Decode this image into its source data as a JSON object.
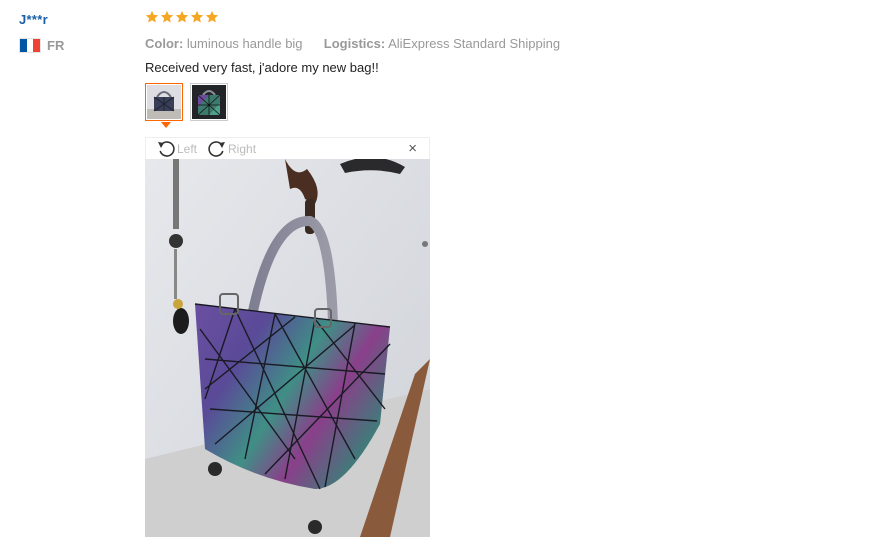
{
  "user": {
    "name": "J***r",
    "country_code": "FR"
  },
  "review": {
    "rating": 5,
    "stars": [
      1,
      2,
      3,
      4,
      5
    ],
    "color_label": "Color:",
    "color_value": "luminous handle big",
    "logistics_label": "Logistics:",
    "logistics_value": "AliExpress Standard Shipping",
    "comment": "Received very fast, j'adore my new bag!!"
  },
  "viewer": {
    "rotate_left": "Left",
    "rotate_right": "Right",
    "close": "×"
  },
  "colors": {
    "star": "#f5a623",
    "accent": "#ff6600",
    "username": "#1a5fa8"
  }
}
